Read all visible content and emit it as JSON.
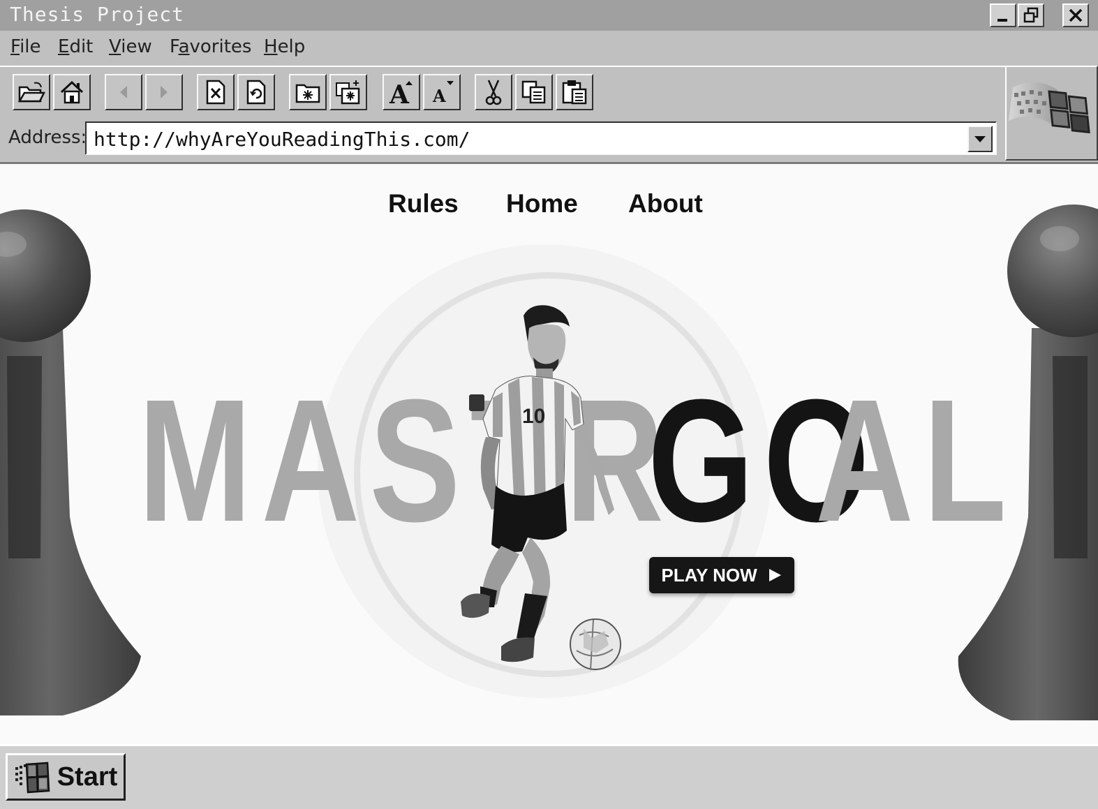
{
  "window": {
    "title": "Thesis Project",
    "controls": [
      "minimize-icon",
      "restore-icon",
      "close-icon"
    ]
  },
  "menu": {
    "items": [
      {
        "label": "File",
        "accel": "F"
      },
      {
        "label": "Edit",
        "accel": "E"
      },
      {
        "label": "View",
        "accel": "V"
      },
      {
        "label": "Favorites",
        "accel": "a"
      },
      {
        "label": "Help",
        "accel": "H"
      }
    ]
  },
  "toolbar": {
    "buttons": [
      "open-folder-icon",
      "home-icon",
      "back-icon",
      "forward-icon",
      "stop-icon",
      "refresh-icon",
      "favorites-icon",
      "add-favorite-icon",
      "font-larger-icon",
      "font-smaller-icon",
      "cut-icon",
      "copy-icon",
      "paste-icon"
    ]
  },
  "address": {
    "label": "Address:",
    "url": "http://whyAreYouReadingThis.com/"
  },
  "site": {
    "nav": [
      "Rules",
      "Home",
      "About"
    ],
    "hero": {
      "word_light_1": "MAST",
      "word_light_2": "R",
      "word_dark": "GO",
      "word_light_3": "AL",
      "cta_label": "PLAY NOW"
    }
  },
  "taskbar": {
    "start_label": "Start"
  },
  "colors": {
    "chrome": "#c0c0c0",
    "titlebar": "#a0a0a0",
    "page_bg": "#fafafa",
    "hero_grey": "#a9a9a9",
    "hero_dark": "#141414"
  }
}
